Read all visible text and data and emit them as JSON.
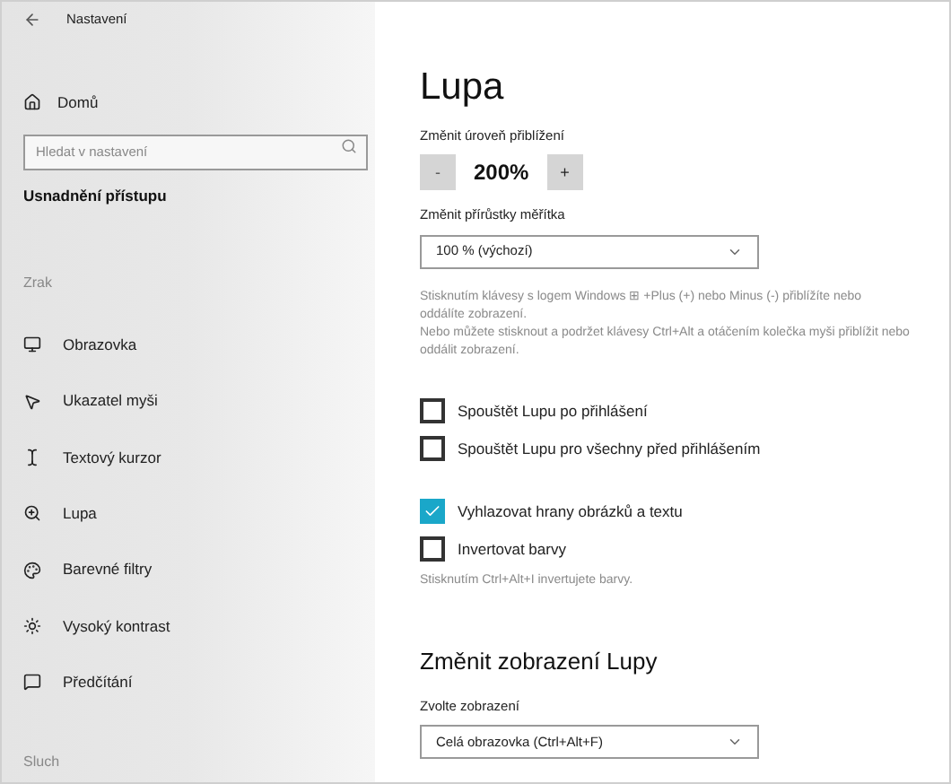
{
  "window": {
    "title": "Nastavení"
  },
  "sidebar": {
    "home": "Domů",
    "search": {
      "placeholder": "Hledat v nastavení"
    },
    "section": "Usnadnění přístupu",
    "group": "Zrak",
    "items": [
      {
        "label": "Obrazovka",
        "kind": "display"
      },
      {
        "label": "Ukazatel myši",
        "kind": "pointer"
      },
      {
        "label": "Textový kurzor",
        "kind": "cursor"
      },
      {
        "label": "Lupa",
        "kind": "magnifier"
      },
      {
        "label": "Barevné filtry",
        "kind": "filters"
      },
      {
        "label": "Vysoký kontrast",
        "kind": "contrast"
      },
      {
        "label": "Předčítání",
        "kind": "narrator"
      }
    ],
    "group_2": "Sluch"
  },
  "page": {
    "title": "Lupa",
    "zoom_label": "Změnit úroveň přiblížení",
    "zoom_minus": "-",
    "zoom_value": "200%",
    "zoom_plus": "+",
    "increment_label": "Změnit přírůstky měřítka",
    "increment_value": "100 % (výchozí)",
    "hint_1": "Stisknutím klávesy s logem Windows ⊞ +Plus (+) nebo Minus (-) přiblížíte nebo oddálíte zobrazení.",
    "hint_2": "Nebo můžete stisknout a podržet klávesy Ctrl+Alt a otáčením kolečka myši přiblížit nebo oddálit zobrazení.",
    "startup": [
      {
        "label": "Spouštět Lupu po přihlášení",
        "checked": false
      },
      {
        "label": "Spouštět Lupu pro všechny před přihlášením",
        "checked": false
      }
    ],
    "options": [
      {
        "label": "Vyhlazovat hrany obrázků a textu",
        "checked": true
      },
      {
        "label": "Invertovat barvy",
        "checked": false
      }
    ],
    "invert_hint": "Stisknutím Ctrl+Alt+I invertujete barvy.",
    "view_heading": "Změnit zobrazení Lupy",
    "view_label": "Zvolte zobrazení",
    "view_value": "Celá obrazovka (Ctrl+Alt+F)"
  }
}
